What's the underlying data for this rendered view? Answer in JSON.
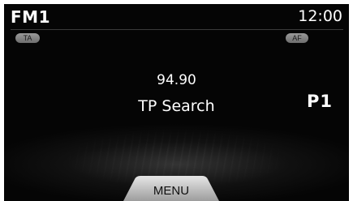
{
  "header": {
    "band": "FM1",
    "clock": "12:00"
  },
  "indicators": {
    "ta_label": "TA",
    "af_label": "AF"
  },
  "main": {
    "frequency": "94.90",
    "status": "TP Search",
    "preset": "P1"
  },
  "footer": {
    "menu_label": "MENU"
  },
  "colors": {
    "background": "#050505",
    "text": "#ffffff",
    "pill": "#8a8a8a",
    "menu_tab": "#c8c8c8"
  }
}
